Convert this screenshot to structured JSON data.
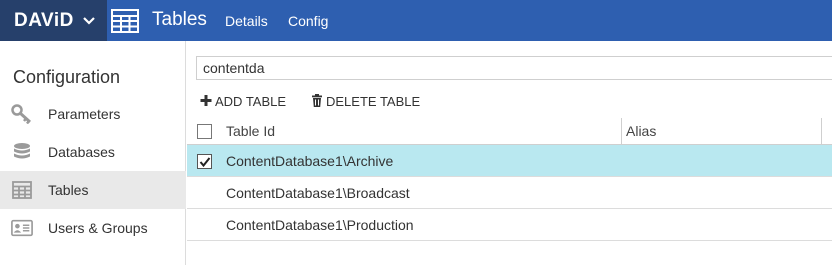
{
  "topbar": {
    "brand": "DAViD",
    "app_title": "Tables",
    "nav": [
      {
        "label": "Details"
      },
      {
        "label": "Config"
      }
    ],
    "color": "#2e5fb0",
    "brand_color": "#26406b"
  },
  "sidebar": {
    "heading": "Configuration",
    "items": [
      {
        "label": "Parameters",
        "icon": "key-icon"
      },
      {
        "label": "Databases",
        "icon": "database-icon"
      },
      {
        "label": "Tables",
        "icon": "table-icon",
        "active": true
      },
      {
        "label": "Users & Groups",
        "icon": "id-card-icon"
      }
    ]
  },
  "search": {
    "value": "contentda"
  },
  "toolbar": {
    "add_label": "ADD TABLE",
    "delete_label": "DELETE TABLE"
  },
  "table": {
    "columns": [
      "Table Id",
      "Alias"
    ],
    "rows": [
      {
        "id": "ContentDatabase1\\Archive",
        "alias": "",
        "checked": true
      },
      {
        "id": "ContentDatabase1\\Broadcast",
        "alias": "",
        "checked": false
      },
      {
        "id": "ContentDatabase1\\Production",
        "alias": "",
        "checked": false
      }
    ],
    "selected_color": "#b9e8f0"
  }
}
